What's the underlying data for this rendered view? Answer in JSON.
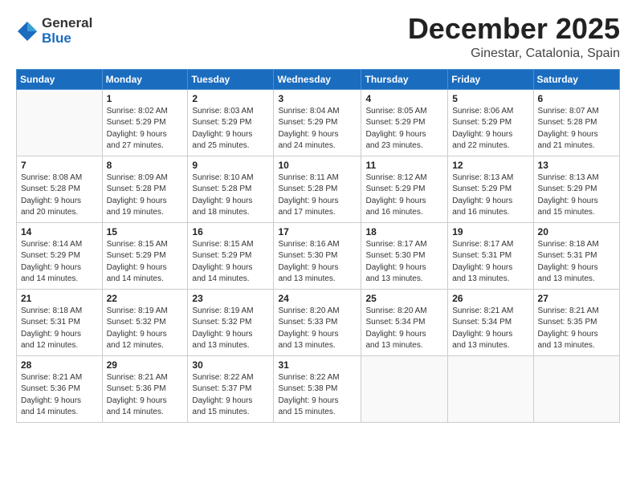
{
  "header": {
    "logo_general": "General",
    "logo_blue": "Blue",
    "month": "December 2025",
    "location": "Ginestar, Catalonia, Spain"
  },
  "days_of_week": [
    "Sunday",
    "Monday",
    "Tuesday",
    "Wednesday",
    "Thursday",
    "Friday",
    "Saturday"
  ],
  "weeks": [
    [
      {
        "day": "",
        "info": ""
      },
      {
        "day": "1",
        "info": "Sunrise: 8:02 AM\nSunset: 5:29 PM\nDaylight: 9 hours\nand 27 minutes."
      },
      {
        "day": "2",
        "info": "Sunrise: 8:03 AM\nSunset: 5:29 PM\nDaylight: 9 hours\nand 25 minutes."
      },
      {
        "day": "3",
        "info": "Sunrise: 8:04 AM\nSunset: 5:29 PM\nDaylight: 9 hours\nand 24 minutes."
      },
      {
        "day": "4",
        "info": "Sunrise: 8:05 AM\nSunset: 5:29 PM\nDaylight: 9 hours\nand 23 minutes."
      },
      {
        "day": "5",
        "info": "Sunrise: 8:06 AM\nSunset: 5:29 PM\nDaylight: 9 hours\nand 22 minutes."
      },
      {
        "day": "6",
        "info": "Sunrise: 8:07 AM\nSunset: 5:28 PM\nDaylight: 9 hours\nand 21 minutes."
      }
    ],
    [
      {
        "day": "7",
        "info": "Sunrise: 8:08 AM\nSunset: 5:28 PM\nDaylight: 9 hours\nand 20 minutes."
      },
      {
        "day": "8",
        "info": "Sunrise: 8:09 AM\nSunset: 5:28 PM\nDaylight: 9 hours\nand 19 minutes."
      },
      {
        "day": "9",
        "info": "Sunrise: 8:10 AM\nSunset: 5:28 PM\nDaylight: 9 hours\nand 18 minutes."
      },
      {
        "day": "10",
        "info": "Sunrise: 8:11 AM\nSunset: 5:28 PM\nDaylight: 9 hours\nand 17 minutes."
      },
      {
        "day": "11",
        "info": "Sunrise: 8:12 AM\nSunset: 5:29 PM\nDaylight: 9 hours\nand 16 minutes."
      },
      {
        "day": "12",
        "info": "Sunrise: 8:13 AM\nSunset: 5:29 PM\nDaylight: 9 hours\nand 16 minutes."
      },
      {
        "day": "13",
        "info": "Sunrise: 8:13 AM\nSunset: 5:29 PM\nDaylight: 9 hours\nand 15 minutes."
      }
    ],
    [
      {
        "day": "14",
        "info": "Sunrise: 8:14 AM\nSunset: 5:29 PM\nDaylight: 9 hours\nand 14 minutes."
      },
      {
        "day": "15",
        "info": "Sunrise: 8:15 AM\nSunset: 5:29 PM\nDaylight: 9 hours\nand 14 minutes."
      },
      {
        "day": "16",
        "info": "Sunrise: 8:15 AM\nSunset: 5:29 PM\nDaylight: 9 hours\nand 14 minutes."
      },
      {
        "day": "17",
        "info": "Sunrise: 8:16 AM\nSunset: 5:30 PM\nDaylight: 9 hours\nand 13 minutes."
      },
      {
        "day": "18",
        "info": "Sunrise: 8:17 AM\nSunset: 5:30 PM\nDaylight: 9 hours\nand 13 minutes."
      },
      {
        "day": "19",
        "info": "Sunrise: 8:17 AM\nSunset: 5:31 PM\nDaylight: 9 hours\nand 13 minutes."
      },
      {
        "day": "20",
        "info": "Sunrise: 8:18 AM\nSunset: 5:31 PM\nDaylight: 9 hours\nand 13 minutes."
      }
    ],
    [
      {
        "day": "21",
        "info": "Sunrise: 8:18 AM\nSunset: 5:31 PM\nDaylight: 9 hours\nand 12 minutes."
      },
      {
        "day": "22",
        "info": "Sunrise: 8:19 AM\nSunset: 5:32 PM\nDaylight: 9 hours\nand 12 minutes."
      },
      {
        "day": "23",
        "info": "Sunrise: 8:19 AM\nSunset: 5:32 PM\nDaylight: 9 hours\nand 13 minutes."
      },
      {
        "day": "24",
        "info": "Sunrise: 8:20 AM\nSunset: 5:33 PM\nDaylight: 9 hours\nand 13 minutes."
      },
      {
        "day": "25",
        "info": "Sunrise: 8:20 AM\nSunset: 5:34 PM\nDaylight: 9 hours\nand 13 minutes."
      },
      {
        "day": "26",
        "info": "Sunrise: 8:21 AM\nSunset: 5:34 PM\nDaylight: 9 hours\nand 13 minutes."
      },
      {
        "day": "27",
        "info": "Sunrise: 8:21 AM\nSunset: 5:35 PM\nDaylight: 9 hours\nand 13 minutes."
      }
    ],
    [
      {
        "day": "28",
        "info": "Sunrise: 8:21 AM\nSunset: 5:36 PM\nDaylight: 9 hours\nand 14 minutes."
      },
      {
        "day": "29",
        "info": "Sunrise: 8:21 AM\nSunset: 5:36 PM\nDaylight: 9 hours\nand 14 minutes."
      },
      {
        "day": "30",
        "info": "Sunrise: 8:22 AM\nSunset: 5:37 PM\nDaylight: 9 hours\nand 15 minutes."
      },
      {
        "day": "31",
        "info": "Sunrise: 8:22 AM\nSunset: 5:38 PM\nDaylight: 9 hours\nand 15 minutes."
      },
      {
        "day": "",
        "info": ""
      },
      {
        "day": "",
        "info": ""
      },
      {
        "day": "",
        "info": ""
      }
    ]
  ]
}
